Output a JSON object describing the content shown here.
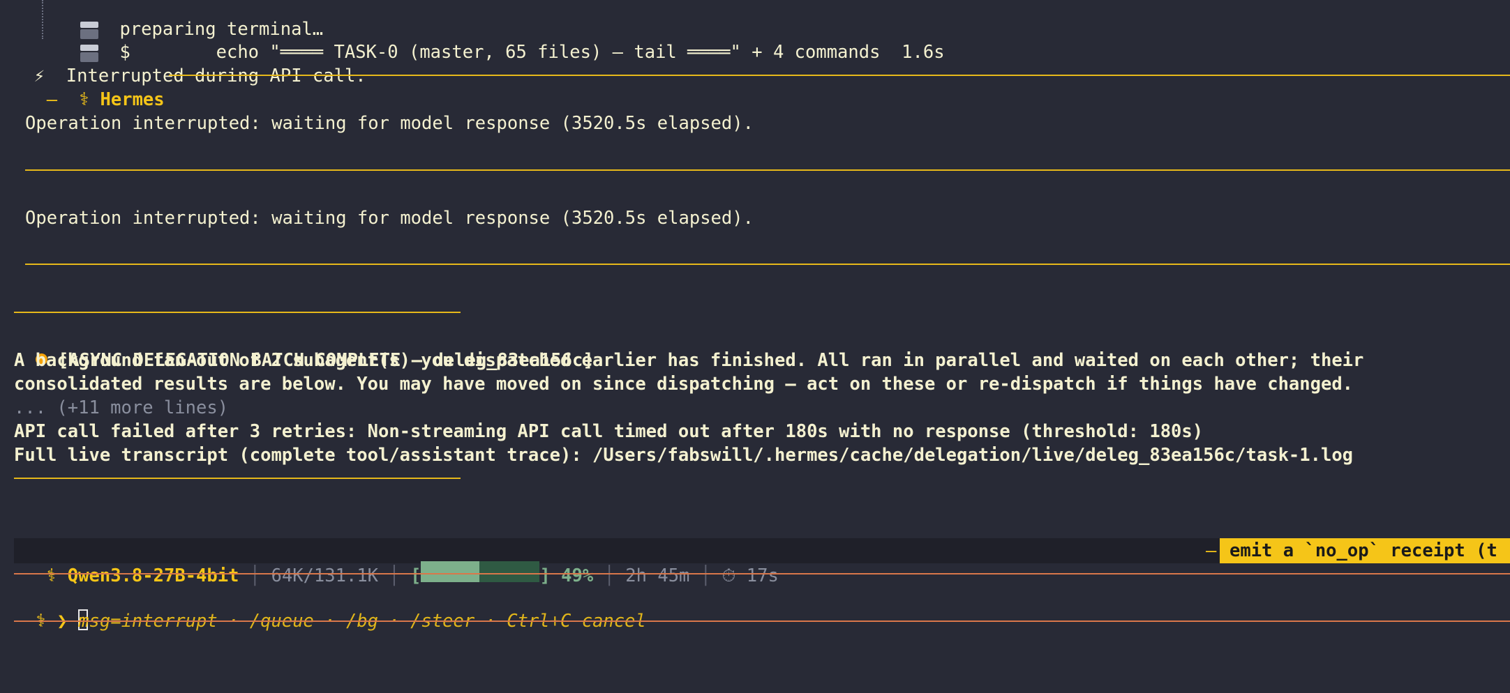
{
  "tree": {
    "preparing": "preparing terminal…",
    "dollar": "$",
    "command": "echo \"════ TASK-0 (master, 65 files) — tail ════\" + 4 commands  1.6s"
  },
  "interrupt_line": {
    "icon": "lightning-icon",
    "text": "Interrupted during API call."
  },
  "hermes_panel": {
    "dash": "—",
    "symbol": "⚕",
    "title": "Hermes",
    "message_1": "Operation interrupted: waiting for model response (3520.5s elapsed).",
    "message_2": "Operation interrupted: waiting for model response (3520.5s elapsed)."
  },
  "delegation": {
    "header": "[ASYNC DELEGATION BATCH COMPLETE — deleg_83ea156c]",
    "line_1": "A background fan-out of 2 subagent(s) you dispatched earlier has finished. All ran in parallel and waited on each other; their",
    "line_2": "consolidated results are below. You may have moved on since dispatching — act on these or re-dispatch if things have changed.",
    "more": "... (+11 more lines)",
    "error": "API call failed after 3 retries: Non-streaming API call timed out after 180s with no response (threshold: 180s)",
    "transcript": "Full live transcript (complete tool/assistant trace): /Users/fabswill/.hermes/cache/delegation/live/deleg_83ea156c/task-1.log"
  },
  "status_bar": {
    "symbol": "⚕",
    "model": "Qwen3.8-27B-4bit",
    "tokens": "64K/131.1K",
    "progress_open": "[",
    "progress_close": "]",
    "progress_fraction": 0.49,
    "progress_label": "49%",
    "session_time": "2h 45m",
    "timer_icon": "timer-icon",
    "elapsed": "17s",
    "tip_dash": "—",
    "tip": "emit a `no_op` receipt (t"
  },
  "prompt": {
    "symbol": "⚕",
    "chevron": "❯",
    "first_char": "m",
    "placeholder": "sg=interrupt · /queue · /bg · /steer · Ctrl+C cancel"
  },
  "colors": {
    "background": "#282a36",
    "accent": "#f5c518",
    "prompt_border": "#d9774a",
    "progress_fill": "#7db08b",
    "bullet": "#f5a30a"
  }
}
